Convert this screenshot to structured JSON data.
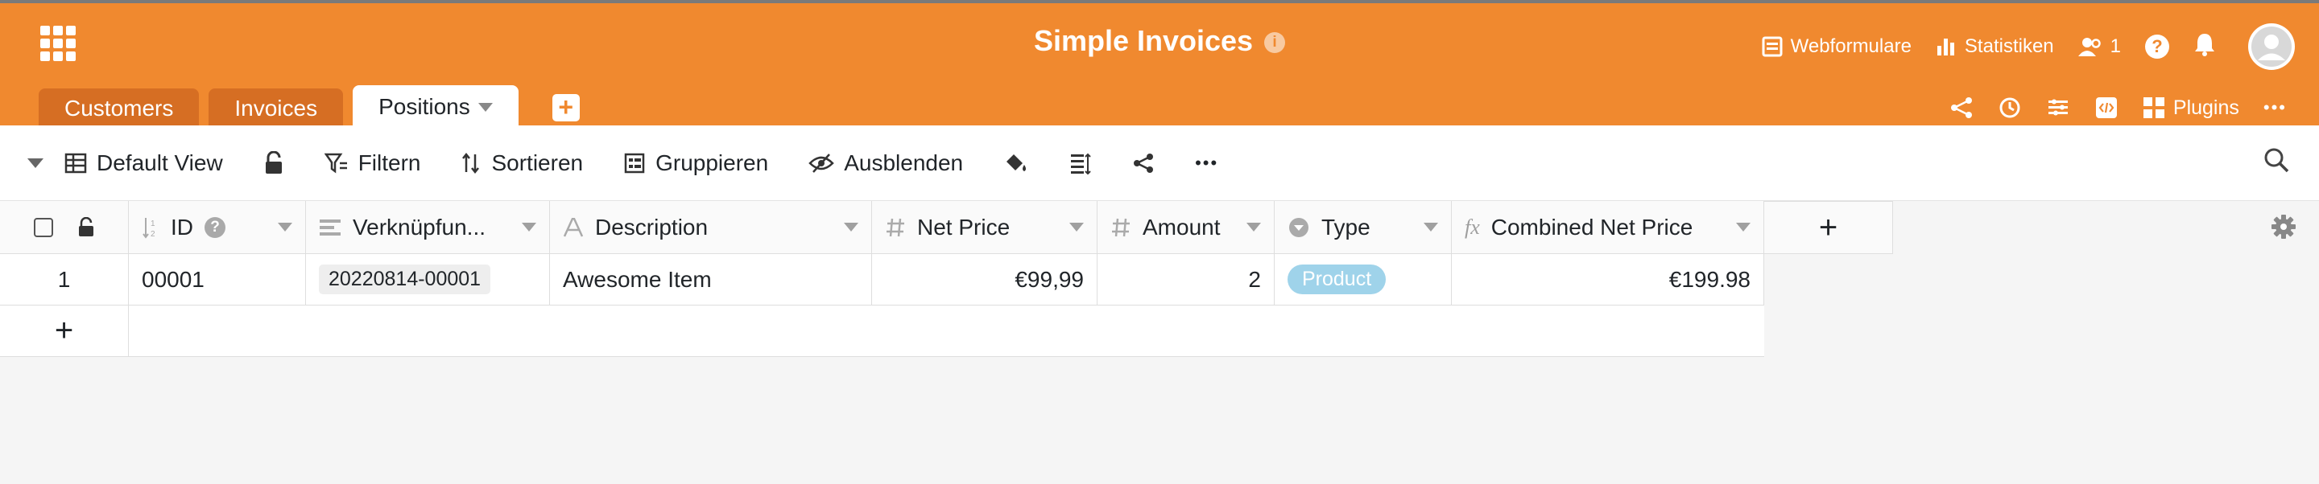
{
  "app": {
    "title": "Simple Invoices",
    "info_glyph": "i",
    "nav": {
      "forms_label": "Webformulare",
      "stats_label": "Statistiken",
      "collaborators_count": "1",
      "help_glyph": "?"
    },
    "accent_color": "#f0892f"
  },
  "tabs": [
    {
      "label": "Customers",
      "active": false
    },
    {
      "label": "Invoices",
      "active": false
    },
    {
      "label": "Positions",
      "active": true
    }
  ],
  "add_tab_glyph": "+",
  "tabs_right": {
    "plugins_label": "Plugins",
    "more_glyph": "•••"
  },
  "toolbar": {
    "view_label": "Default View",
    "filter_label": "Filtern",
    "sort_label": "Sortieren",
    "group_label": "Gruppieren",
    "hide_label": "Ausblenden",
    "more_glyph": "•••"
  },
  "columns": [
    {
      "label": "ID",
      "icon": "autonumber-icon"
    },
    {
      "label": "Verknüpfun...",
      "icon": "link-icon"
    },
    {
      "label": "Description",
      "icon": "text-icon"
    },
    {
      "label": "Net Price",
      "icon": "number-icon"
    },
    {
      "label": "Amount",
      "icon": "number-icon"
    },
    {
      "label": "Type",
      "icon": "single-select-icon"
    },
    {
      "label": "Combined Net Price",
      "icon": "formula-icon"
    }
  ],
  "rows": [
    {
      "index": "1",
      "id": "00001",
      "link": "20220814-00001",
      "description": "Awesome Item",
      "net_price": "€99,99",
      "amount": "2",
      "type": "Product",
      "combined": "€199.98"
    }
  ],
  "glyphs": {
    "add_column": "+",
    "add_row": "+",
    "id_help": "?",
    "formula": "fx"
  }
}
